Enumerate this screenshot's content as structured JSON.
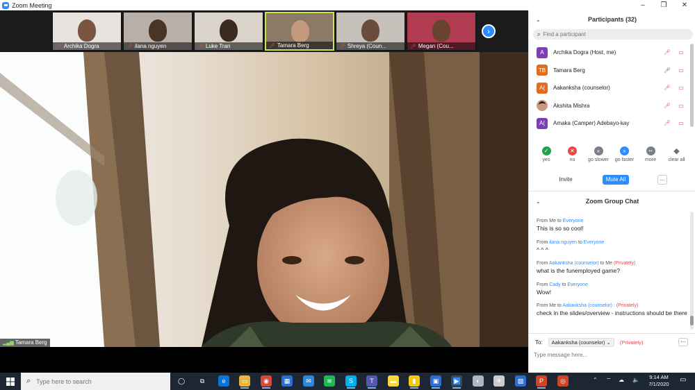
{
  "window": {
    "title": "Zoom Meeting",
    "minimize": "–",
    "maximize": "❐",
    "close": "✕"
  },
  "thumbnails": [
    {
      "name": "Archika Dogra",
      "bg": "#e9e3df",
      "face": "#7a5542"
    },
    {
      "name": "ilana nguyen",
      "bg": "#b8b0a8",
      "face": "#4a3426"
    },
    {
      "name": "Luke Tran",
      "bg": "#d9d3c9",
      "face": "#3a2a20"
    },
    {
      "name": "Tamara Berg",
      "bg": "#8a7a66",
      "face": "#c49a7e"
    },
    {
      "name": "Shreya (Coun...",
      "bg": "#c6c2bb",
      "face": "#6b4b3b"
    },
    {
      "name": "Megan (Cou...",
      "bg": "#b13c52",
      "face": "#6a4330"
    }
  ],
  "next_icon": "›",
  "speaker": {
    "name": "Tamara Berg"
  },
  "participants": {
    "title": "Participants (32)",
    "search_placeholder": "Find a participant",
    "list": [
      {
        "name": "Archika Dogra (Host, me)",
        "initials": "A",
        "color": "#7b3fb5",
        "mic": "muted"
      },
      {
        "name": "Tamara Berg",
        "initials": "TB",
        "color": "#e46c1e",
        "mic": "on"
      },
      {
        "name": "Aakanksha (counselor)",
        "initials": "A(",
        "color": "#e46c1e",
        "mic": "muted"
      },
      {
        "name": "Akshita Mishra",
        "initials": "",
        "color": "#8a4a3a",
        "mic": "muted"
      },
      {
        "name": "Amaka (Camper) Adebayo-kay",
        "initials": "A(",
        "color": "#7b3fb5",
        "mic": "muted"
      }
    ],
    "reactions": [
      {
        "label": "yes",
        "glyph": "✓",
        "color": "#22a34a"
      },
      {
        "label": "no",
        "glyph": "✕",
        "color": "#e54b4b"
      },
      {
        "label": "go slower",
        "glyph": "«",
        "color": "#7a7f8a"
      },
      {
        "label": "go faster",
        "glyph": "»",
        "color": "#2d8cff"
      },
      {
        "label": "more",
        "glyph": "•••",
        "color": "#7a7f8a"
      },
      {
        "label": "clear all",
        "glyph": "◆",
        "color": "#6a6f78"
      }
    ],
    "invite_label": "Invite",
    "mute_all_label": "Mute All",
    "more_label": "..."
  },
  "chat": {
    "title": "Zoom Group Chat",
    "messages": [
      {
        "from": "Me",
        "to": "Everyone",
        "private": "",
        "text": "This is so so cool!"
      },
      {
        "from": "ilana nguyen",
        "to": "Everyone",
        "private": "",
        "text": "^ ^ ^"
      },
      {
        "from": "Aakanksha (counselor)",
        "to": "Me",
        "private": "(Privately)",
        "text": "what is the funemployed game?"
      },
      {
        "from": "Cady",
        "to": "Everyone",
        "private": "",
        "text": "Wow!"
      },
      {
        "from": "Me",
        "to": "Aakanksha (counselor) :",
        "private": "(Privately)",
        "text": "check in the slides/overview - instructions should be there"
      }
    ],
    "from_word": "From",
    "to_word": "to",
    "to_label": "To:",
    "recipient": "Aakanksha (counselor)",
    "privately": "(Privately)",
    "input_placeholder": "Type message here...",
    "more_label": "···"
  },
  "taskbar": {
    "search_placeholder": "Type here to search",
    "time": "9:14 AM",
    "date": "7/1/2020"
  }
}
